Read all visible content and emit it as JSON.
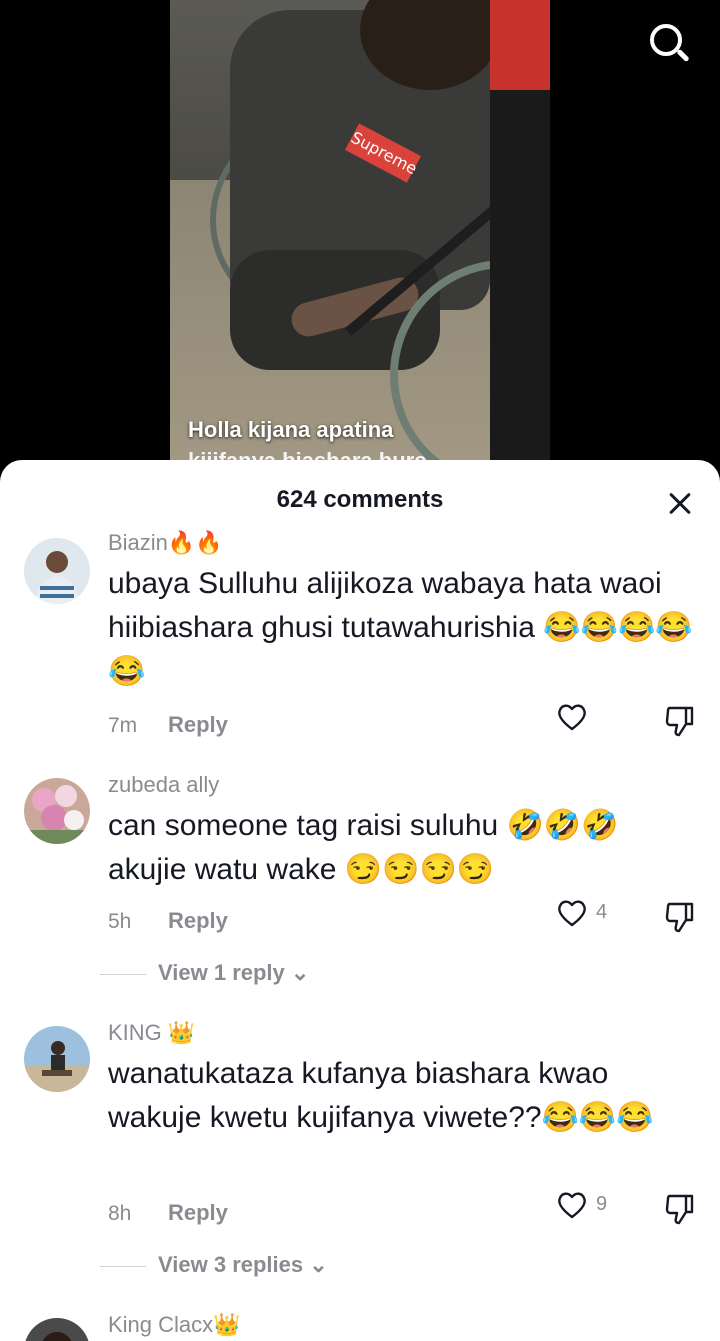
{
  "video": {
    "caption_line1": "Holla kijana apatina",
    "caption_line2": "kijifanya biashara bure",
    "logo_text": "Supreme"
  },
  "sheet": {
    "comment_count": "624 comments"
  },
  "comments": [
    {
      "username": "Biazin🔥🔥",
      "text": "ubaya Sulluhu alijikoza wabaya hata waoi hiibiashara ghusi tutawahurishia 😂😂😂😂😂",
      "time": "7m",
      "reply_label": "Reply",
      "likes": ""
    },
    {
      "username": "zubeda ally",
      "text": "can someone tag raisi suluhu 🤣🤣🤣 akujie watu wake 😏😏😏😏",
      "time": "5h",
      "reply_label": "Reply",
      "likes": "4",
      "view_replies": "View 1 reply ⌄"
    },
    {
      "username": "KING 👑",
      "text": "wanatukataza kufanya biashara kwao wakuje kwetu kujifanya viwete??😂😂😂",
      "time": "8h",
      "reply_label": "Reply",
      "likes": "9",
      "view_replies": "View 3 replies ⌄"
    },
    {
      "username": "King Clacx👑"
    }
  ],
  "colors": {
    "text_primary": "#161823",
    "text_secondary": "#8a8b91",
    "sheet_bg": "#ffffff"
  },
  "icons": [
    "search-icon",
    "close-icon",
    "heart-icon",
    "dislike-icon",
    "chevron-down-icon"
  ]
}
